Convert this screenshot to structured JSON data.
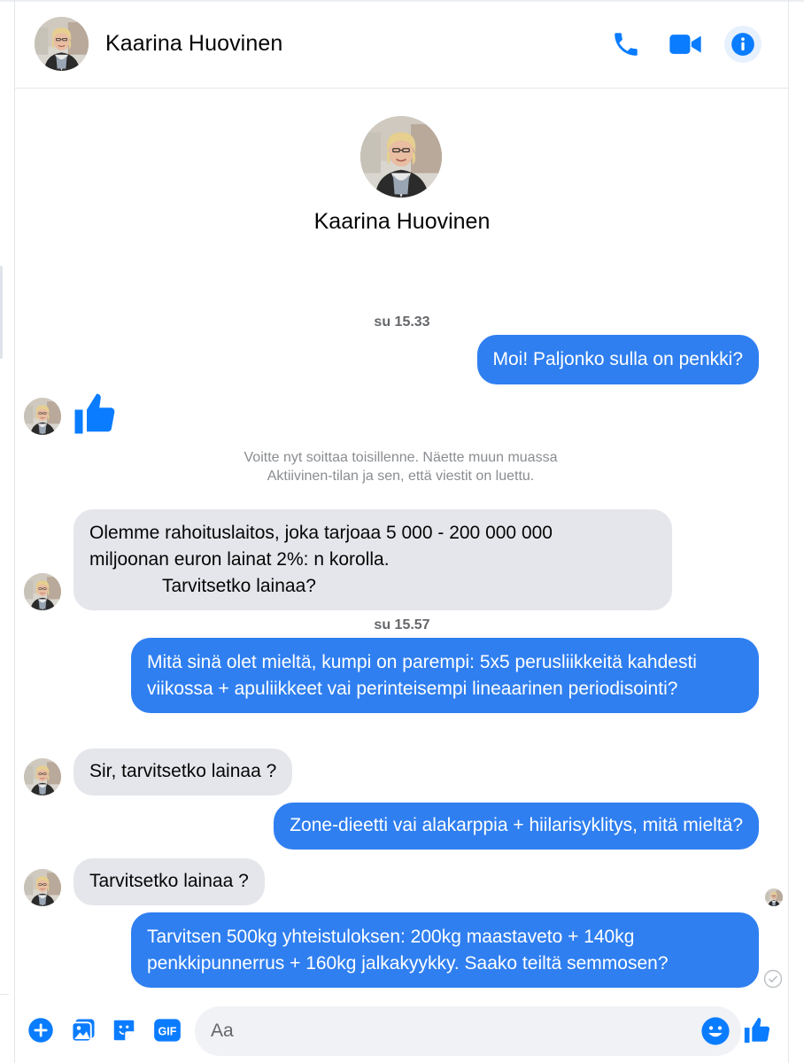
{
  "contact": {
    "name": "Kaarina Huovinen"
  },
  "header": {
    "icons": [
      "phone-icon",
      "video-camera-icon",
      "info-icon"
    ]
  },
  "colors": {
    "accent": "#0a7cff",
    "outgoing_bubble": "#2f7ff0",
    "incoming_bubble": "#e4e6eb",
    "timestamp": "#65676b"
  },
  "thread": {
    "timestamps": [
      "su 15.33",
      "su 15.57"
    ],
    "system_note": "Voitte nyt soittaa toisillenne. Näette muun muassa Aktiivinen-tilan ja sen, että viestit on luettu.",
    "messages": [
      {
        "direction": "out",
        "text": "Moi! Paljonko sulla on penkki?"
      },
      {
        "direction": "in",
        "type": "like"
      },
      {
        "direction": "in",
        "line1": "Olemme rahoituslaitos, joka tarjoaa 5 000 - 200 000 000",
        "line2": "miljoonan euron lainat 2%: n korolla.",
        "line3": "Tarvitsetko lainaa?"
      },
      {
        "direction": "out",
        "text": "Mitä sinä olet mieltä, kumpi on parempi: 5x5 perusliikkeitä kahdesti viikossa + apuliikkeet vai perinteisempi lineaarinen periodisointi?"
      },
      {
        "direction": "in",
        "text": "Sir, tarvitsetko lainaa ?"
      },
      {
        "direction": "out",
        "text": "Zone-dieetti vai alakarppia + hiilarisyklitys, mitä mieltä?"
      },
      {
        "direction": "in",
        "text": "Tarvitsetko lainaa ?"
      },
      {
        "direction": "out",
        "text": "Tarvitsen 500kg yhteistuloksen: 200kg maastaveto + 140kg penkkipunnerrus + 160kg jalkakyykky. Saako teiltä semmosen?"
      }
    ]
  },
  "composer": {
    "placeholder": "Aa",
    "icons": [
      "plus-icon",
      "photo-icon",
      "sticker-icon",
      "gif-icon",
      "emoji-icon",
      "like-icon"
    ],
    "gif_label": "GIF"
  }
}
